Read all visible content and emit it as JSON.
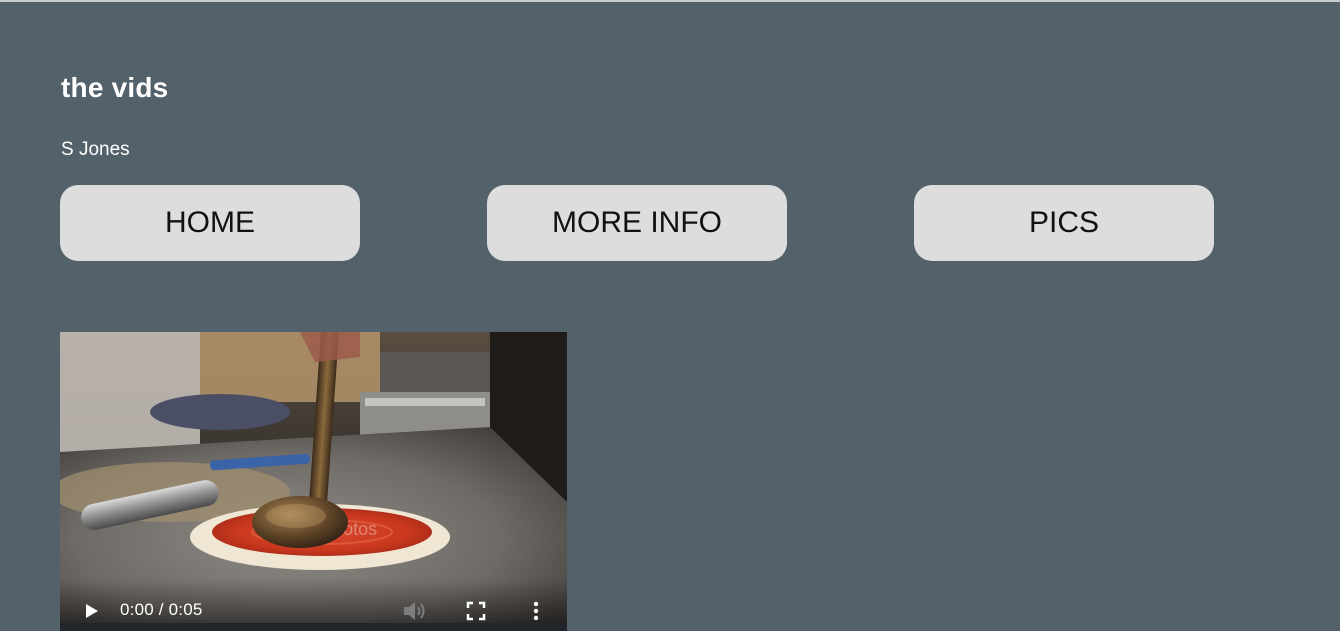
{
  "header": {
    "title": "the vids",
    "author": "S Jones"
  },
  "nav": {
    "home_label": "HOME",
    "more_info_label": "MORE INFO",
    "pics_label": "PICS"
  },
  "video": {
    "current_time": "0:00",
    "duration": "0:05",
    "time_display": "0:00 / 0:05",
    "watermark": "depositphotos",
    "progress": 0,
    "icons": {
      "play": "play-icon",
      "mute": "volume-icon",
      "fullscreen": "fullscreen-icon",
      "more": "more-vert-icon"
    }
  },
  "colors": {
    "background": "#53616b",
    "button_bg": "#dddddd",
    "button_text": "#111111",
    "title_text": "#ffffff"
  }
}
